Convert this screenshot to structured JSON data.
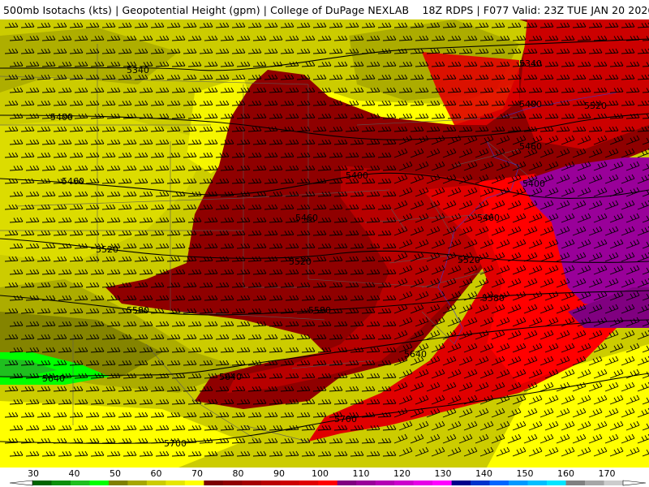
{
  "header": {
    "title": "500mb Isotachs (kts) | Geopotential Height (gpm) | College of DuPage NEXLAB    18Z RDPS | F077 Valid: 23Z TUE JAN 20 2026"
  },
  "map": {
    "height_contours": [
      {
        "label": "5340"
      },
      {
        "label": "5400"
      },
      {
        "label": "5460"
      },
      {
        "label": "5520"
      },
      {
        "label": "5580"
      },
      {
        "label": "5640"
      },
      {
        "label": "5700"
      }
    ],
    "contour_labels": [
      {
        "text": "5340"
      },
      {
        "text": "5400"
      },
      {
        "text": "5460"
      },
      {
        "text": "5520"
      },
      {
        "text": "5580"
      },
      {
        "text": "5640"
      },
      {
        "text": "5640"
      },
      {
        "text": "5700"
      },
      {
        "text": "5400"
      },
      {
        "text": "5460"
      },
      {
        "text": "5520"
      },
      {
        "text": "5580"
      },
      {
        "text": "5640"
      },
      {
        "text": "5700"
      },
      {
        "text": "5460"
      },
      {
        "text": "5520"
      },
      {
        "text": "5580"
      },
      {
        "text": "5400"
      },
      {
        "text": "5340"
      },
      {
        "text": "5400"
      },
      {
        "text": "5460"
      },
      {
        "text": "5520"
      }
    ]
  },
  "legend": {
    "ticks": [
      "30",
      "40",
      "50",
      "60",
      "70",
      "80",
      "90",
      "100",
      "110",
      "120",
      "130",
      "140",
      "150",
      "160",
      "170"
    ],
    "colors": [
      "#006400",
      "#0b8f0b",
      "#1fbf1f",
      "#00ff00",
      "#7f7f00",
      "#a6a600",
      "#cccc00",
      "#e6e600",
      "#ffff00",
      "#7a0000",
      "#8f0000",
      "#a30000",
      "#b80000",
      "#cc0000",
      "#e00000",
      "#ff0000",
      "#800080",
      "#990099",
      "#b300b3",
      "#cc00cc",
      "#e600e6",
      "#ff00ff",
      "#00008b",
      "#0033cc",
      "#0066ff",
      "#0099ff",
      "#00bfff",
      "#00e5ff",
      "#808080",
      "#a6a6a6",
      "#cccccc"
    ]
  }
}
